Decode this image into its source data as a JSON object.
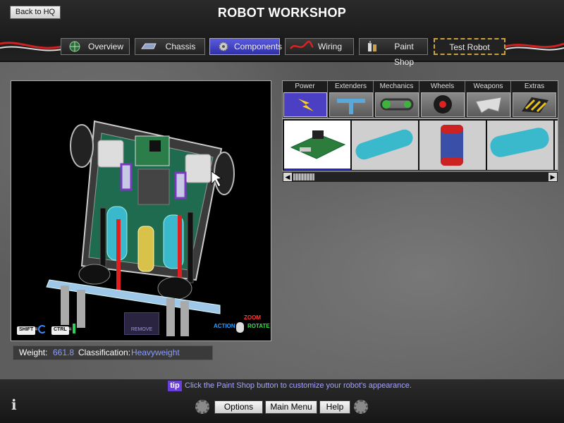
{
  "header": {
    "back_label": "Back to HQ",
    "title": "ROBOT WORKSHOP",
    "tabs": [
      {
        "label": "Overview",
        "icon": "globe-icon",
        "active": false
      },
      {
        "label": "Chassis",
        "icon": "chassis-icon",
        "active": false
      },
      {
        "label": "Components",
        "icon": "gear-icon",
        "active": true
      },
      {
        "label": "Wiring",
        "icon": "wire-icon",
        "active": false
      },
      {
        "label": "Paint Shop",
        "icon": "paint-icon",
        "active": false
      },
      {
        "label": "Test Robot",
        "icon": "",
        "active": false
      }
    ]
  },
  "viewport": {
    "remove_label": "REMOVE",
    "controls": {
      "shift": "SHIFT",
      "ctrl": "CTRL",
      "eq": "=",
      "action": "ACTION",
      "zoom": "ZOOM",
      "rotate": "ROTATE"
    }
  },
  "info": {
    "weight_label": "Weight:",
    "weight_value": "661.8",
    "class_label": "Classification:",
    "class_value": "Heavyweight"
  },
  "categories": [
    {
      "label": "Power",
      "icon": "lightning-icon",
      "selected": true
    },
    {
      "label": "Extenders",
      "icon": "t-beam-icon",
      "selected": false
    },
    {
      "label": "Mechanics",
      "icon": "chain-icon",
      "selected": false
    },
    {
      "label": "Wheels",
      "icon": "wheel-icon",
      "selected": false
    },
    {
      "label": "Weapons",
      "icon": "blade-icon",
      "selected": false
    },
    {
      "label": "Extras",
      "icon": "hazard-icon",
      "selected": false
    }
  ],
  "parts": [
    {
      "name": "circuit-board-part",
      "selected": true
    },
    {
      "name": "pneumatic-tank-part",
      "selected": false
    },
    {
      "name": "battery-can-part",
      "selected": false
    },
    {
      "name": "co2-tank-part",
      "selected": false
    }
  ],
  "colors": {
    "accent": "#4b3fc4",
    "stat_value": "#8d9cff",
    "tip_text": "#a6a4ff",
    "test_border": "#c9a23a"
  },
  "footer": {
    "tip_badge": "tip",
    "tip_text": "Click the Paint Shop button to customize your robot's appearance.",
    "options": "Options",
    "main_menu": "Main Menu",
    "help": "Help"
  }
}
